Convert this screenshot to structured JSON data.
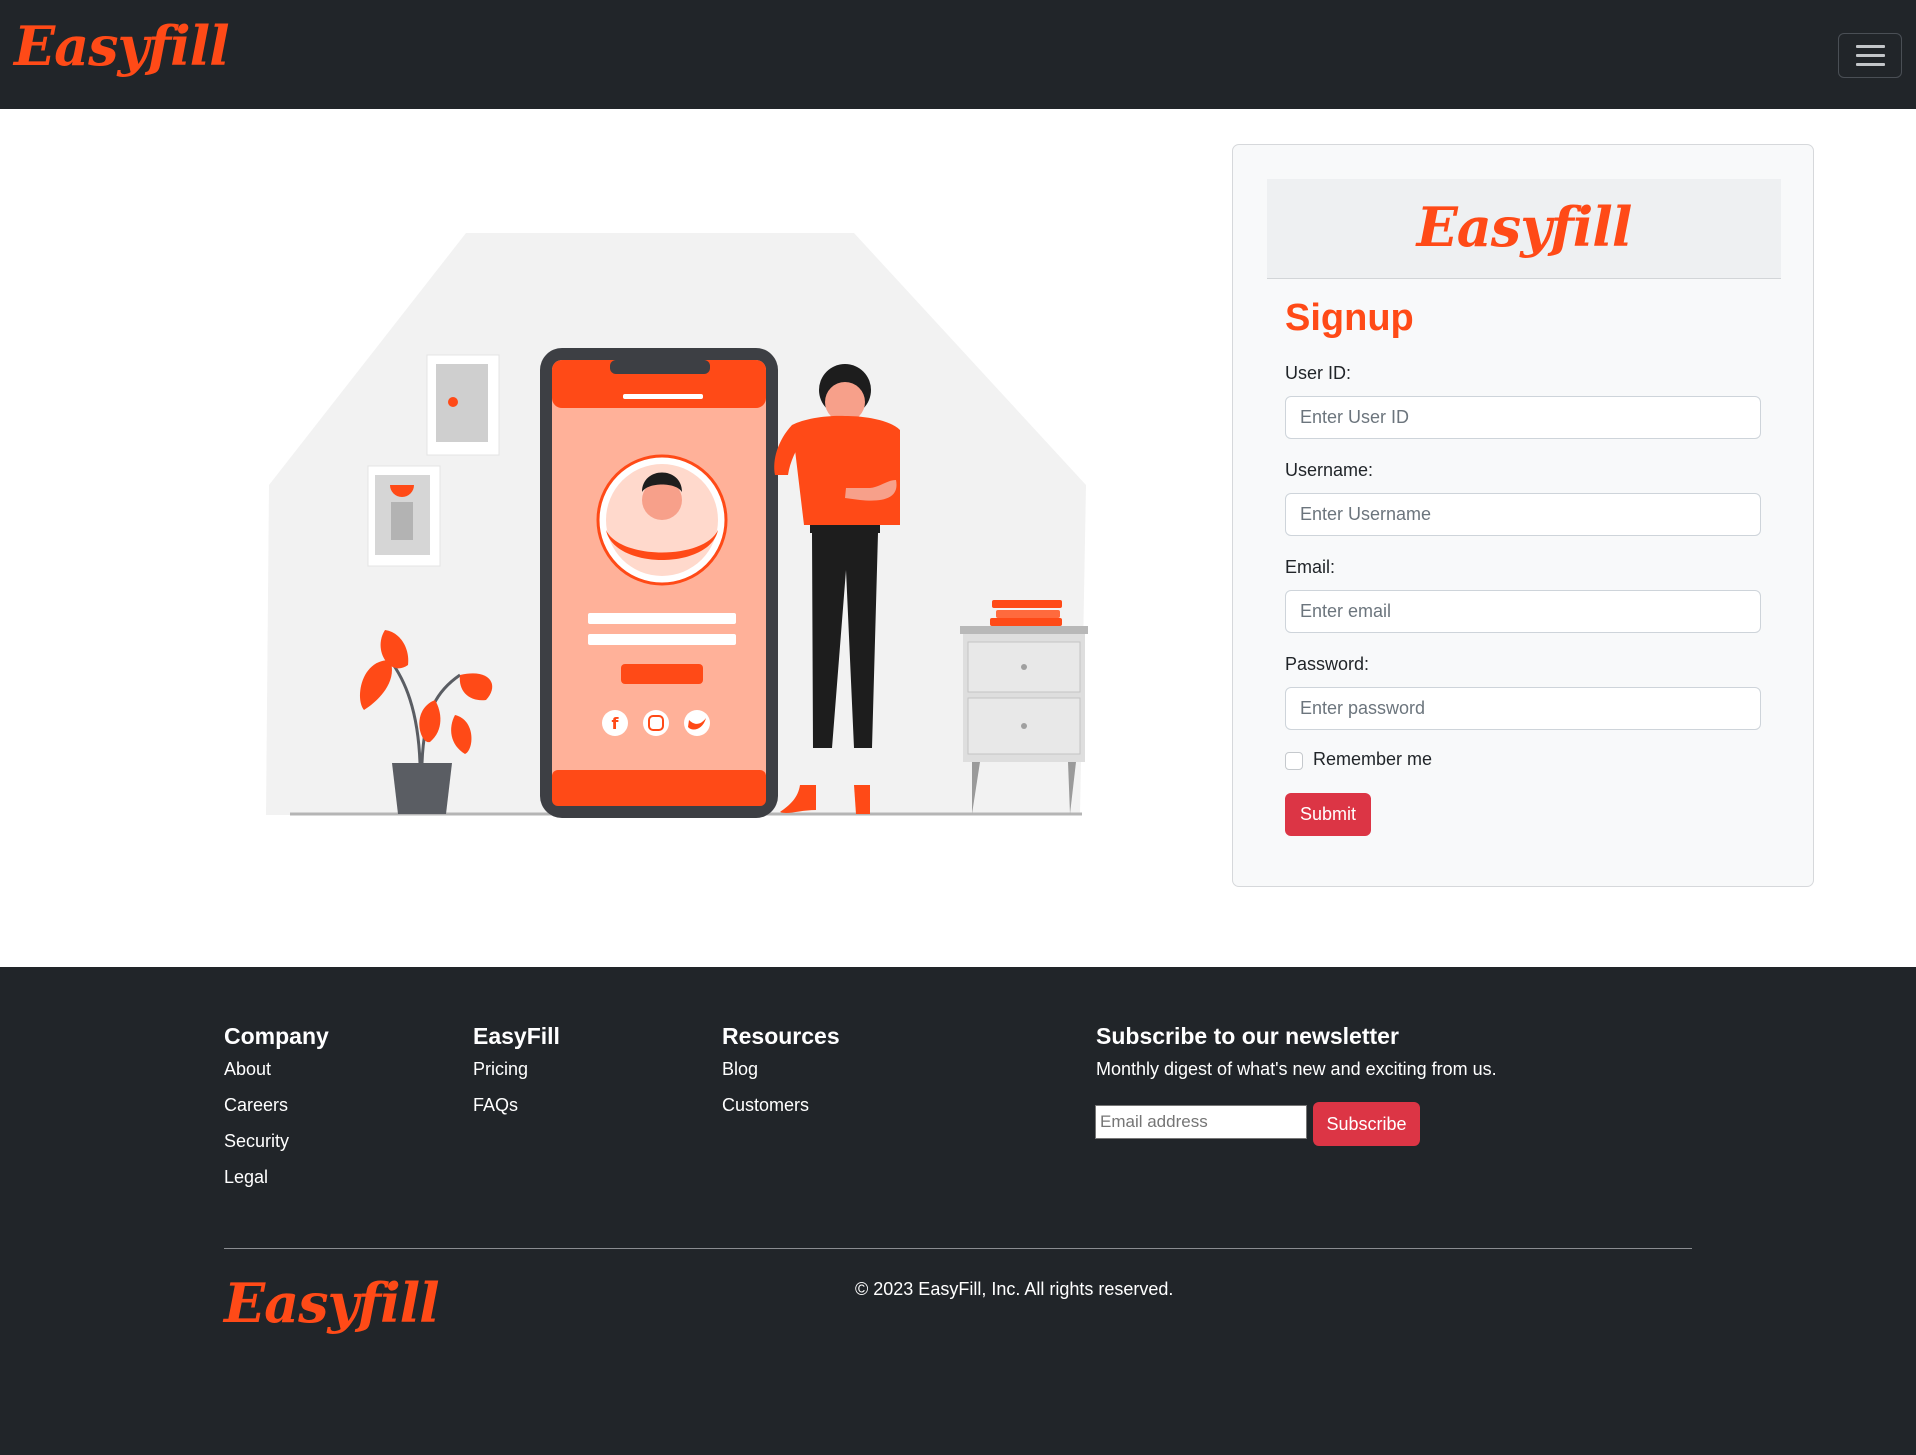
{
  "brand": {
    "logo_text": "Easyfill",
    "accent_color": "#ff4a17",
    "danger_color": "#dc3545",
    "dark_color": "#212529"
  },
  "navbar": {
    "toggler_icon": "hamburger-icon"
  },
  "signup": {
    "title": "Signup",
    "fields": [
      {
        "label": "User ID:",
        "placeholder": "Enter User ID"
      },
      {
        "label": "Username:",
        "placeholder": "Enter Username"
      },
      {
        "label": "Email:",
        "placeholder": "Enter email"
      },
      {
        "label": "Password:",
        "placeholder": "Enter password"
      }
    ],
    "remember_label": "Remember me",
    "submit_label": "Submit"
  },
  "footer": {
    "columns": [
      {
        "title": "Company",
        "links": [
          "About",
          "Careers",
          "Security",
          "Legal"
        ]
      },
      {
        "title": "EasyFill",
        "links": [
          "Pricing",
          "FAQs"
        ]
      },
      {
        "title": "Resources",
        "links": [
          "Blog",
          "Customers"
        ]
      }
    ],
    "newsletter": {
      "title": "Subscribe to our newsletter",
      "description": "Monthly digest of what's new and exciting from us.",
      "email_placeholder": "Email address",
      "button_label": "Subscribe"
    },
    "copyright": "© 2023 EasyFill, Inc. All rights reserved."
  }
}
